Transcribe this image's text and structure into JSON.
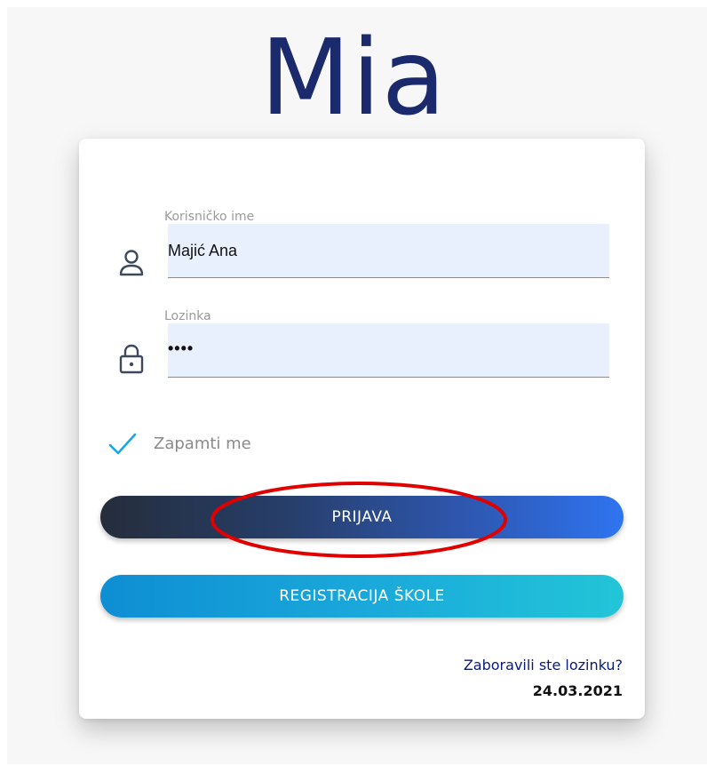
{
  "app": {
    "logo_text": "Mia"
  },
  "login_form": {
    "username": {
      "label": "Korisničko ime",
      "value": "Majić Ana",
      "icon": "user-icon"
    },
    "password": {
      "label": "Lozinka",
      "value": "••••",
      "icon": "lock-icon"
    },
    "remember_me": {
      "label": "Zapamti me",
      "checked": true,
      "icon": "checkmark-icon"
    },
    "login_button": "PRIJAVA",
    "register_button": "REGISTRACIJA ŠKOLE",
    "forgot_password_link": "Zaboravili ste lozinku?",
    "date": "24.03.2021"
  },
  "colors": {
    "logo": "#1a2a6c",
    "input_bg": "#e8f0fe",
    "checkmark": "#1ea5e0",
    "login_gradient_start": "#252d3b",
    "login_gradient_end": "#2f74f0",
    "register_gradient_start": "#0e8ed3",
    "register_gradient_end": "#22c5d8",
    "link": "#0a1a7a",
    "annotation": "#e00000"
  }
}
